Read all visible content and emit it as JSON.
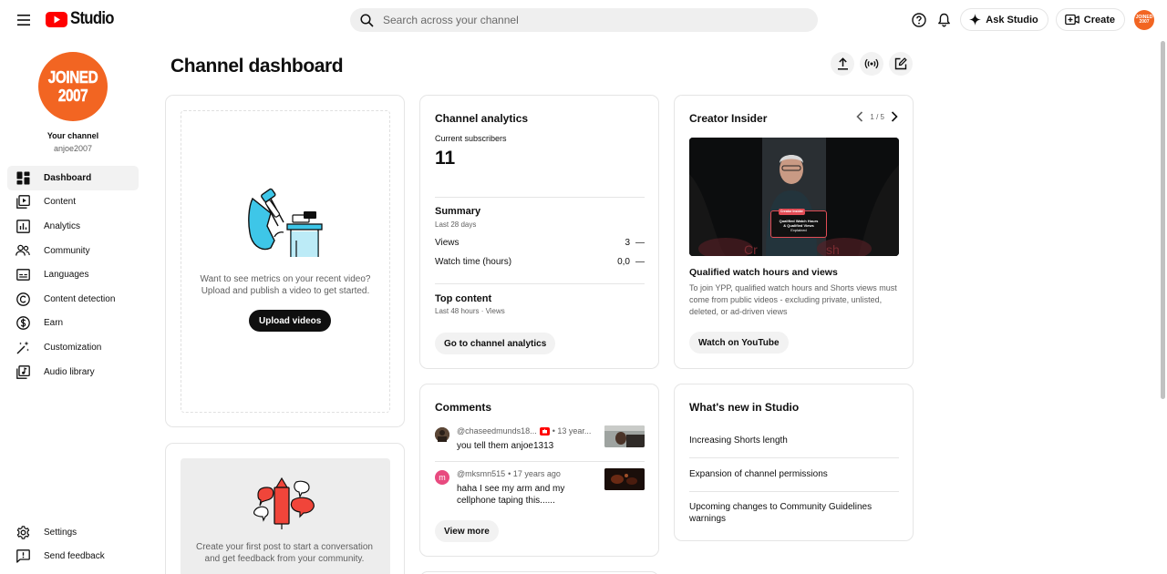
{
  "topbar": {
    "logo_text": "Studio",
    "search_placeholder": "Search across your channel",
    "ask_studio_label": "Ask Studio",
    "create_label": "Create",
    "avatar_line1": "JOINED",
    "avatar_line2": "2007"
  },
  "sidebar": {
    "avatar_line1": "JOINED",
    "avatar_line2": "2007",
    "your_channel": "Your channel",
    "handle": "anjoe2007",
    "items": [
      {
        "label": "Dashboard",
        "icon": "dashboard-icon",
        "active": true
      },
      {
        "label": "Content",
        "icon": "content-icon"
      },
      {
        "label": "Analytics",
        "icon": "analytics-icon"
      },
      {
        "label": "Community",
        "icon": "community-icon"
      },
      {
        "label": "Languages",
        "icon": "languages-icon"
      },
      {
        "label": "Content detection",
        "icon": "copyright-icon"
      },
      {
        "label": "Earn",
        "icon": "dollar-icon"
      },
      {
        "label": "Customization",
        "icon": "magic-wand-icon"
      },
      {
        "label": "Audio library",
        "icon": "audio-library-icon"
      }
    ],
    "bottom_items": [
      {
        "label": "Settings",
        "icon": "gear-icon"
      },
      {
        "label": "Send feedback",
        "icon": "feedback-icon"
      }
    ]
  },
  "main": {
    "page_title": "Channel dashboard"
  },
  "upload_card": {
    "text_line1": "Want to see metrics on your recent video?",
    "text_line2": "Upload and publish a video to get started.",
    "button_label": "Upload videos"
  },
  "post_card": {
    "text_line1": "Create your first post to start a conversation",
    "text_line2": "and get feedback from your community."
  },
  "analytics": {
    "title": "Channel analytics",
    "subscribers_label": "Current subscribers",
    "subscribers_value": "11",
    "summary_title": "Summary",
    "summary_period": "Last 28 days",
    "views_label": "Views",
    "views_value": "3",
    "views_change": "—",
    "watch_label": "Watch time (hours)",
    "watch_value": "0,0",
    "watch_change": "—",
    "top_content_title": "Top content",
    "top_content_period": "Last 48 hours · Views",
    "button_label": "Go to channel analytics"
  },
  "comments": {
    "title": "Comments",
    "items": [
      {
        "author": "@chaseedmunds18...",
        "time": "• 13 year...",
        "text": "you tell them anjoe1313"
      },
      {
        "author": "@mksmn515",
        "time": "• 17 years ago",
        "text": "haha I see my arm and my cellphone taping this......",
        "avatar_letter": "m"
      }
    ],
    "button_label": "View more"
  },
  "insider": {
    "title": "Creator Insider",
    "pager": "1 / 5",
    "thumb_badge": "Creator Insider",
    "thumb_caption_1": "Qualified Watch Hours",
    "thumb_caption_2": "& Qualified Views",
    "thumb_caption_3": "Explained",
    "thumb_bg_text_left": "Cr",
    "thumb_bg_text_right": "sh",
    "video_title": "Qualified watch hours and views",
    "video_desc": "To join YPP, qualified watch hours and Shorts views must come from public videos - excluding private, unlisted, deleted, or ad-driven views",
    "button_label": "Watch on YouTube"
  },
  "whats_new": {
    "title": "What's new in Studio",
    "items": [
      "Increasing Shorts length",
      "Expansion of channel permissions",
      "Upcoming changes to Community Guidelines warnings"
    ]
  },
  "colors": {
    "brand_red": "#ff0000",
    "avatar_orange": "#f26522",
    "illustration_blue": "#3ec6e8",
    "illustration_red": "#f0453a",
    "comment_avatar_pink": "#e84a7f"
  }
}
